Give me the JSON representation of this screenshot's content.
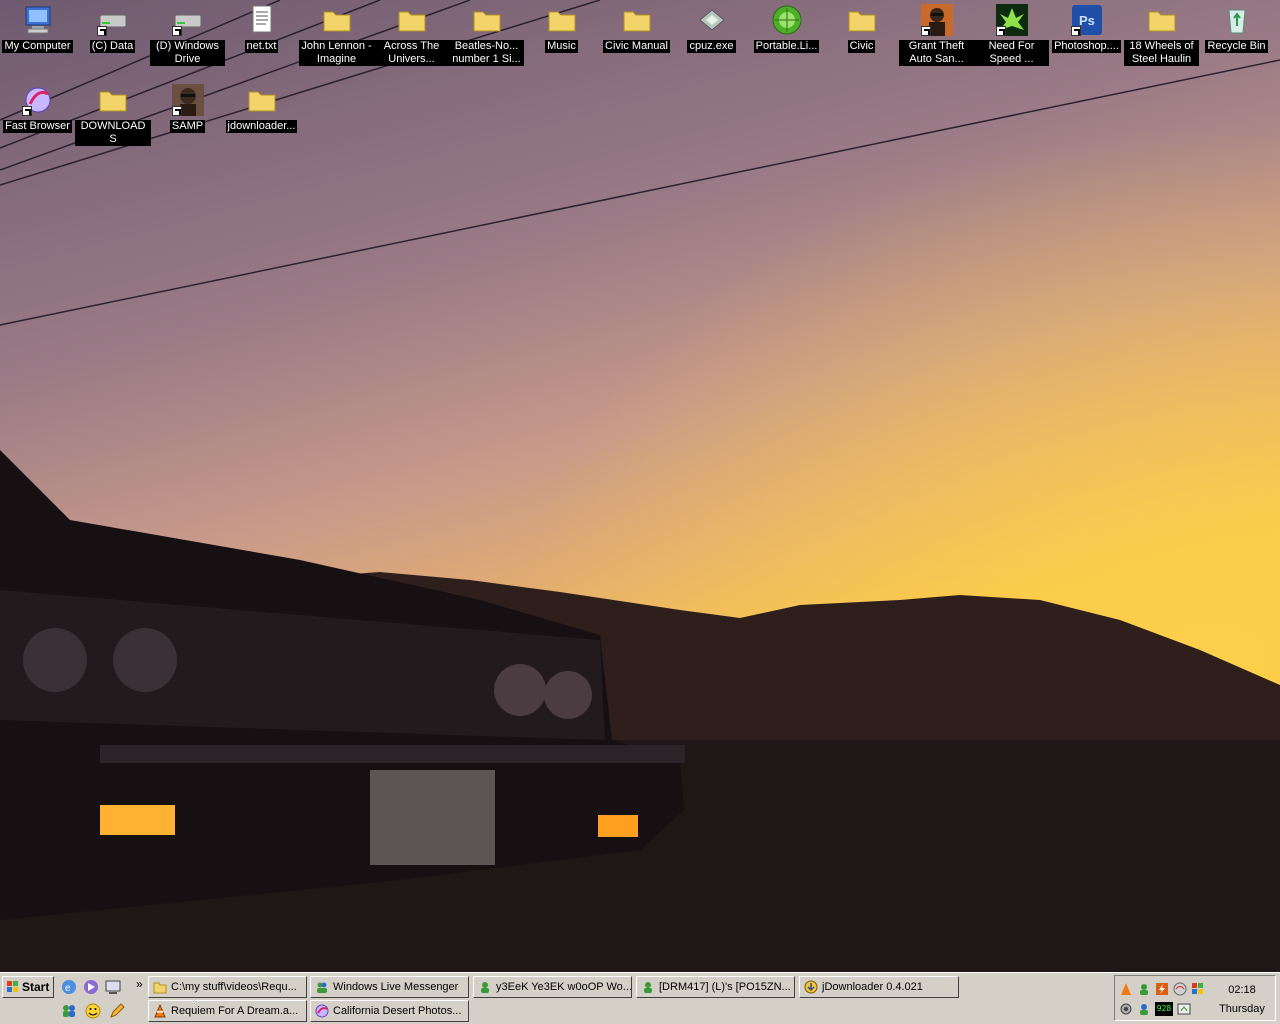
{
  "desktop": {
    "icons": [
      {
        "label": "My Computer",
        "icon": "my-computer-icon"
      },
      {
        "label": "(C) Data",
        "icon": "drive-icon"
      },
      {
        "label": "(D) Windows Drive",
        "icon": "drive-shortcut-icon"
      },
      {
        "label": "net.txt",
        "icon": "text-file-icon"
      },
      {
        "label": "John Lennon - Imagine",
        "icon": "folder-icon"
      },
      {
        "label": "Across The Univers...",
        "icon": "folder-icon"
      },
      {
        "label": "Beatles-No... number 1 Si...",
        "icon": "folder-icon"
      },
      {
        "label": "Music",
        "icon": "folder-icon"
      },
      {
        "label": "Civic Manual",
        "icon": "folder-icon"
      },
      {
        "label": "cpuz.exe",
        "icon": "chip-icon"
      },
      {
        "label": "Portable.Li...",
        "icon": "portable-app-icon"
      },
      {
        "label": "Civic",
        "icon": "folder-icon"
      },
      {
        "label": "Grant Theft Auto San...",
        "icon": "gta-icon"
      },
      {
        "label": "Need For Speed ...",
        "icon": "nfs-icon"
      },
      {
        "label": "Photoshop....",
        "icon": "photoshop-icon"
      },
      {
        "label": "18 Wheels of Steel Haulin",
        "icon": "folder-icon"
      },
      {
        "label": "Recycle Bin",
        "icon": "recycle-bin-icon"
      },
      {
        "label": "Fast Browser",
        "icon": "browser-icon"
      },
      {
        "label": "DOWNLOADS",
        "icon": "folder-icon"
      },
      {
        "label": "SAMP",
        "icon": "samp-icon"
      },
      {
        "label": "jdownloader...",
        "icon": "folder-icon"
      }
    ]
  },
  "taskbar": {
    "start_label": "Start",
    "quick_launch": [
      "ie-icon",
      "media-icon",
      "show-desktop-icon",
      "messenger-icon",
      "emoticon-icon",
      "pencil-icon"
    ],
    "chevron": "»",
    "tasks": [
      {
        "label": "C:\\my stuff\\videos\\Requ...",
        "icon": "folder-icon"
      },
      {
        "label": "Windows Live Messenger",
        "icon": "messenger-icon"
      },
      {
        "label": "y3EeK Ye3EK w0oOP Wo...",
        "icon": "messenger-icon"
      },
      {
        "label": "[DRM417] (L)'s [PO15ZN...",
        "icon": "messenger-icon"
      },
      {
        "label": "jDownloader 0.4.021",
        "icon": "jdownloader-icon"
      },
      {
        "label": "Requiem For A Dream.a...",
        "icon": "vlc-icon"
      },
      {
        "label": "California Desert Photos...",
        "icon": "browser-icon"
      }
    ],
    "tray": {
      "icons": [
        "vlc-icon",
        "messenger-icon",
        "flash-icon",
        "network-icon",
        "windows-flag-icon",
        "speaker-icon",
        "messenger-icon",
        "cpu-meter-icon",
        "volume-icon"
      ],
      "cpu_readout": "928",
      "time": "02:18",
      "day": "Thursday"
    }
  },
  "colors": {
    "taskbar": "#d4d0c8",
    "label_bg": "#000000",
    "folder": "#f3d46a",
    "sky_top": "#7a6478",
    "sky_horizon": "#f2bf55"
  }
}
